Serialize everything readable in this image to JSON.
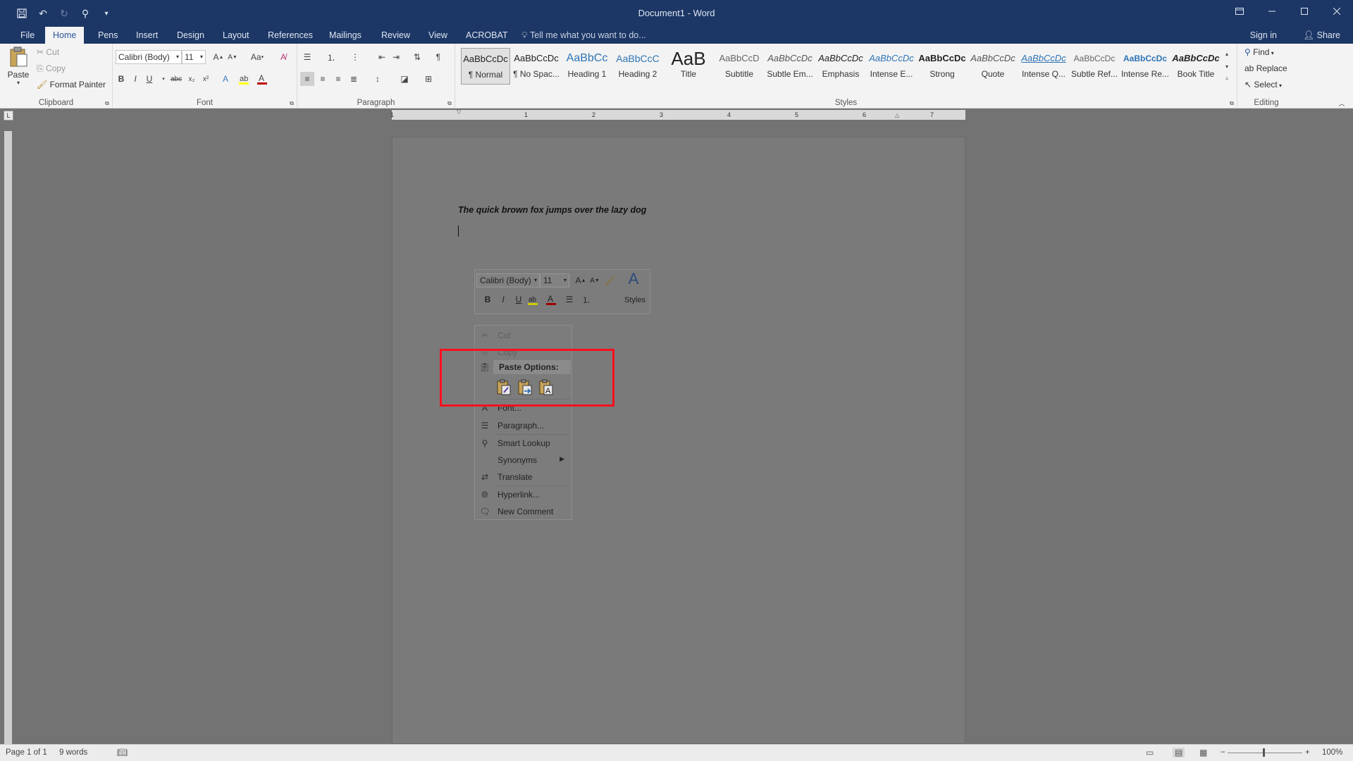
{
  "title_bar": {
    "document_title": "Document1 - Word",
    "qat_icons": [
      "save-icon",
      "undo-icon",
      "redo-icon",
      "touch-mode-icon",
      "customize-qat-icon"
    ],
    "window_icons": [
      "ribbon-display-icon",
      "minimize-icon",
      "maximize-icon",
      "close-icon"
    ]
  },
  "tabs": {
    "items": [
      "File",
      "Home",
      "Pens",
      "Insert",
      "Design",
      "Layout",
      "References",
      "Mailings",
      "Review",
      "View",
      "ACROBAT"
    ],
    "active": "Home",
    "tell_me": "Tell me what you want to do...",
    "sign_in": "Sign in",
    "share": "Share"
  },
  "ribbon": {
    "clipboard": {
      "label": "Clipboard",
      "paste": "Paste",
      "cut": "Cut",
      "copy": "Copy",
      "format_painter": "Format Painter"
    },
    "font": {
      "label": "Font",
      "font_name": "Calibri (Body)",
      "font_size": "11",
      "bold": "B",
      "italic": "I",
      "underline": "U",
      "strike": "abc",
      "subscript": "x₂",
      "superscript": "x²",
      "change_case": "Aa",
      "grow": "A",
      "shrink": "A"
    },
    "paragraph": {
      "label": "Paragraph"
    },
    "styles": {
      "label": "Styles",
      "items": [
        {
          "sample": "AaBbCcDc",
          "name": "¶ Normal"
        },
        {
          "sample": "AaBbCcDc",
          "name": "¶ No Spac..."
        },
        {
          "sample": "AaBbCc",
          "name": "Heading 1"
        },
        {
          "sample": "AaBbCcC",
          "name": "Heading 2"
        },
        {
          "sample": "AaB",
          "name": "Title"
        },
        {
          "sample": "AaBbCcD",
          "name": "Subtitle"
        },
        {
          "sample": "AaBbCcDc",
          "name": "Subtle Em..."
        },
        {
          "sample": "AaBbCcDc",
          "name": "Emphasis"
        },
        {
          "sample": "AaBbCcDc",
          "name": "Intense E..."
        },
        {
          "sample": "AaBbCcDc",
          "name": "Strong"
        },
        {
          "sample": "AaBbCcDc",
          "name": "Quote"
        },
        {
          "sample": "AaBbCcDc",
          "name": "Intense Q..."
        },
        {
          "sample": "AaBbCcDc",
          "name": "Subtle Ref..."
        },
        {
          "sample": "AaBbCcDc",
          "name": "Intense Re..."
        },
        {
          "sample": "AaBbCcDc",
          "name": "Book Title"
        }
      ]
    },
    "editing": {
      "label": "Editing",
      "find": "Find",
      "replace": "Replace",
      "select": "Select"
    }
  },
  "ruler": {
    "numbers": [
      "1",
      "1",
      "2",
      "3",
      "4",
      "5",
      "6",
      "7"
    ]
  },
  "document": {
    "text": "The quick brown fox jumps over the lazy dog"
  },
  "mini_toolbar": {
    "font_name": "Calibri (Body)",
    "font_size": "11",
    "styles_label": "Styles",
    "bold": "B",
    "italic": "I",
    "underline": "U"
  },
  "context_menu": {
    "cut": "Cut",
    "copy": "Copy",
    "paste_options": "Paste Options:",
    "font": "Font...",
    "paragraph": "Paragraph...",
    "smart_lookup": "Smart Lookup",
    "synonyms": "Synonyms",
    "translate": "Translate",
    "hyperlink": "Hyperlink...",
    "new_comment": "New Comment"
  },
  "status_bar": {
    "page": "Page 1 of 1",
    "words": "9 words",
    "zoom": "100%",
    "zoom_minus": "−",
    "zoom_plus": "+"
  },
  "colors": {
    "title_bar": "#1c3765",
    "ribbon": "#f3f3f3",
    "highlight": "#ff0f1f",
    "font_color_bar": "#c00000",
    "highlight_color_bar": "#ffff00"
  }
}
